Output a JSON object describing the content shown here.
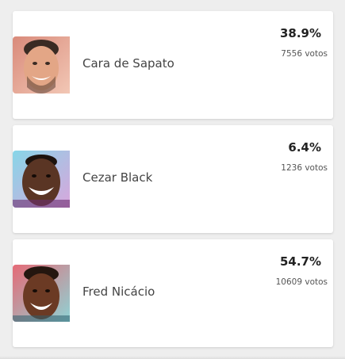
{
  "poll": {
    "candidates": [
      {
        "name": "Cara de Sapato",
        "percent": "38.9%",
        "votes": "7556 votos",
        "photo_icon": "candidate-photo",
        "photo_bg": [
          "#d98a7a",
          "#f0b9a6"
        ],
        "skin": "#e3a686",
        "hair": "#3a2b23"
      },
      {
        "name": "Cezar Black",
        "percent": "6.4%",
        "votes": "1236 votos",
        "photo_icon": "candidate-photo",
        "photo_bg": [
          "#87d6e8",
          "#d9a6dc"
        ],
        "skin": "#5a3524",
        "hair": "#1d130e"
      },
      {
        "name": "Fred Nicácio",
        "percent": "54.7%",
        "votes": "10609 votos",
        "photo_icon": "candidate-photo",
        "photo_bg": [
          "#e56a76",
          "#8fd3d5"
        ],
        "skin": "#6b3a24",
        "hair": "#24160f"
      }
    ]
  },
  "colors": {
    "page_background": "#eeeeee",
    "card_background": "#ffffff",
    "name_text": "#444444",
    "percent_text": "#222222",
    "votes_text": "#555555"
  }
}
